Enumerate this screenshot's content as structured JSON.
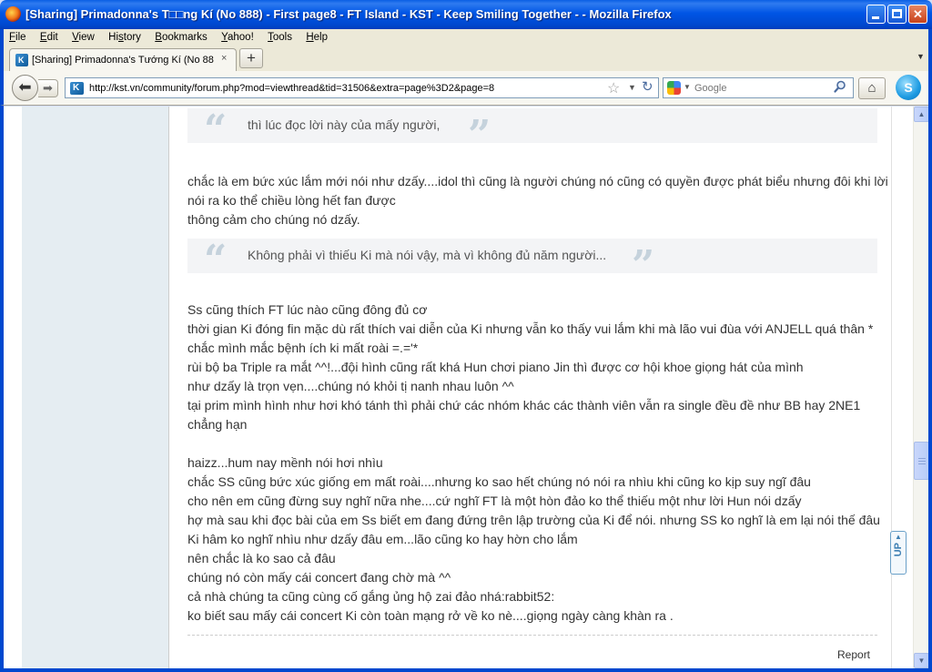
{
  "window": {
    "title": "[Sharing] Primadonna's T□□ng Kí (No 888) - First page8 - FT Island - KST - Keep Smiling Together - - Mozilla Firefox"
  },
  "menu": {
    "items": [
      {
        "key": "F",
        "rest": "ile"
      },
      {
        "key": "E",
        "rest": "dit"
      },
      {
        "key": "V",
        "rest": "iew"
      },
      {
        "key": "",
        "pre": "Hi",
        "key2": "s",
        "rest": "tory"
      },
      {
        "key": "B",
        "rest": "ookmarks"
      },
      {
        "key": "Y",
        "rest": "ahoo!"
      },
      {
        "key": "T",
        "rest": "ools"
      },
      {
        "key": "H",
        "rest": "elp"
      }
    ]
  },
  "tab": {
    "label": "[Sharing] Primadonna's Tướng Kí (No 888) - ...",
    "close": "×",
    "new": "+"
  },
  "nav": {
    "url": "http://kst.vn/community/forum.php?mod=viewthread&tid=31506&extra=page%3D2&page=8",
    "search_placeholder": "Google"
  },
  "post": {
    "quote1": "thì lúc đọc lời này của mấy người,",
    "para1": [
      "chắc là em bức xúc lắm mới nói như dzấy....idol thì cũng là người chúng nó cũng có quyền được phát biểu nhưng đôi khi lời",
      "nói ra ko thể chiều lòng hết fan được",
      "thông cảm cho chúng nó dzấy."
    ],
    "quote2": "Không phải vì thiếu Ki mà nói vậy, mà vì không đủ năm người...",
    "para2": [
      "Ss cũng thích FT lúc nào cũng đông đủ cơ",
      "thời gian Ki đóng fin mặc dù rất thích vai diễn của Ki nhưng vẫn ko thấy vui lắm khi mà lão vui đùa với ANJELL quá thân *",
      "chắc mình mắc bệnh ích ki mất roài =.='*",
      "rùi bộ ba Triple ra mắt ^^!...đội hình cũng rất khá Hun chơi piano Jin thì được cơ hội khoe giọng hát của mình",
      "như dzấy là trọn vẹn....chúng nó khỏi tị nanh nhau luôn ^^",
      "tại prim mình hình như hơi khó tánh thì phải chứ các nhóm khác các thành viên vẫn ra single đều đề như BB hay 2NE1",
      "chẳng hạn"
    ],
    "para3": [
      "haizz...hum nay mềnh nói hơi nhìu",
      "chắc SS cũng bức xúc giống em mất roài....nhưng ko sao hết chúng nó nói ra nhìu khi cũng ko kịp suy ngĩ đâu",
      "cho nên em cũng đừng suy nghĩ nữa nhe....cứ nghĩ FT là một hòn đảo ko thể thiếu một như lời Hun nói dzấy",
      "hợ mà sau khi đọc bài của em Ss biết em đang đứng trên lập trường của Ki để nói. nhưng SS ko nghĩ là em lại nói thế đâu",
      "Ki hâm ko nghĩ nhìu như dzấy đâu em...lão cũng ko hay hờn cho lắm",
      "nên chắc là ko sao cả đâu",
      "chúng nó còn mấy cái concert đang chờ mà ^^",
      "cả nhà chúng ta cũng cùng cố gắng ủng hộ zai đảo nhá:rabbit52:",
      "ko biết sau mấy cái concert Ki còn toàn mạng rở về ko nè....giọng ngày càng khàn ra ."
    ],
    "report": "Report"
  },
  "float_top": "UP"
}
